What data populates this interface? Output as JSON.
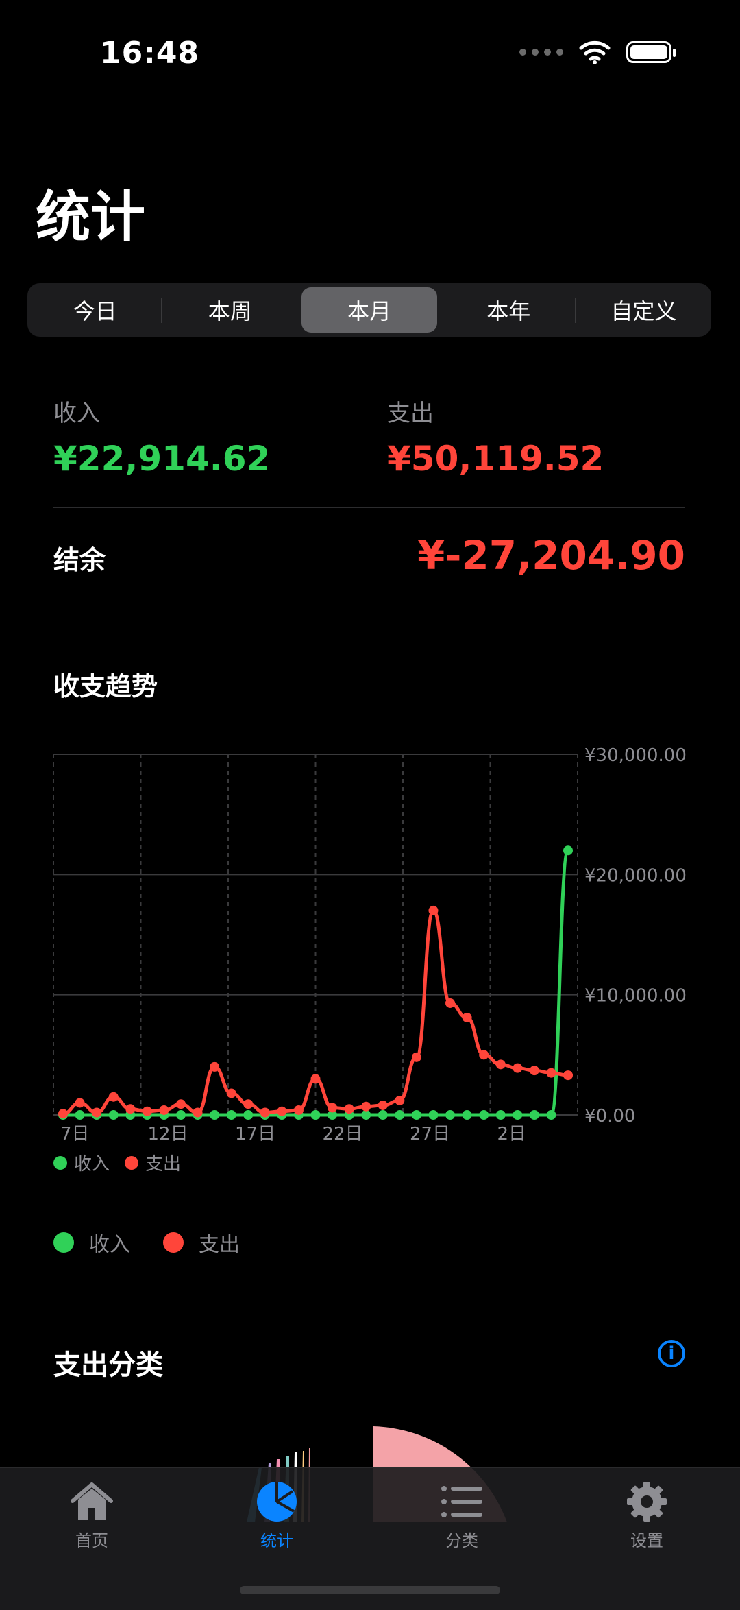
{
  "status_bar": {
    "time": "16:48"
  },
  "page": {
    "title": "统计"
  },
  "segments": [
    {
      "label": "今日",
      "selected": false
    },
    {
      "label": "本周",
      "selected": false
    },
    {
      "label": "本月",
      "selected": true
    },
    {
      "label": "本年",
      "selected": false
    },
    {
      "label": "自定义",
      "selected": false
    }
  ],
  "summary": {
    "income_label": "收入",
    "income_value": "¥22,914.62",
    "expense_label": "支出",
    "expense_value": "¥50,119.52",
    "balance_label": "结余",
    "balance_value": "¥-27,204.90"
  },
  "trend": {
    "title": "收支趋势",
    "legend": [
      {
        "label": "收入",
        "color": "#30d158"
      },
      {
        "label": "支出",
        "color": "#ff453a"
      }
    ]
  },
  "chart_data": {
    "type": "line",
    "y_ticks": [
      "¥30,000.00",
      "¥20,000.00",
      "¥10,000.00",
      "¥0.00"
    ],
    "x_ticks": [
      "7日",
      "12日",
      "17日",
      "22日",
      "27日",
      "2日"
    ],
    "ylim": [
      0,
      30000
    ],
    "grid": true,
    "legend_position": "bottom-left",
    "series": [
      {
        "name": "收入",
        "color": "#30d158",
        "values": [
          0,
          0,
          0,
          0,
          0,
          0,
          0,
          0,
          0,
          0,
          0,
          0,
          0,
          0,
          0,
          0,
          0,
          0,
          0,
          0,
          0,
          0,
          0,
          0,
          0,
          0,
          0,
          0,
          0,
          0,
          22000
        ]
      },
      {
        "name": "支出",
        "color": "#ff453a",
        "values": [
          100,
          1000,
          200,
          1500,
          500,
          300,
          400,
          900,
          200,
          4000,
          1800,
          900,
          200,
          300,
          400,
          3000,
          600,
          500,
          700,
          800,
          1200,
          4800,
          17000,
          9300,
          8100,
          5000,
          4200,
          3900,
          3700,
          3500,
          3300
        ]
      }
    ]
  },
  "category": {
    "title": "支出分类",
    "info_icon": "info-circle-icon"
  },
  "tabs": [
    {
      "label": "首页",
      "icon": "house-icon",
      "active": false
    },
    {
      "label": "统计",
      "icon": "pie-chart-icon",
      "active": true
    },
    {
      "label": "分类",
      "icon": "list-icon",
      "active": false
    },
    {
      "label": "设置",
      "icon": "gear-icon",
      "active": false
    }
  ]
}
